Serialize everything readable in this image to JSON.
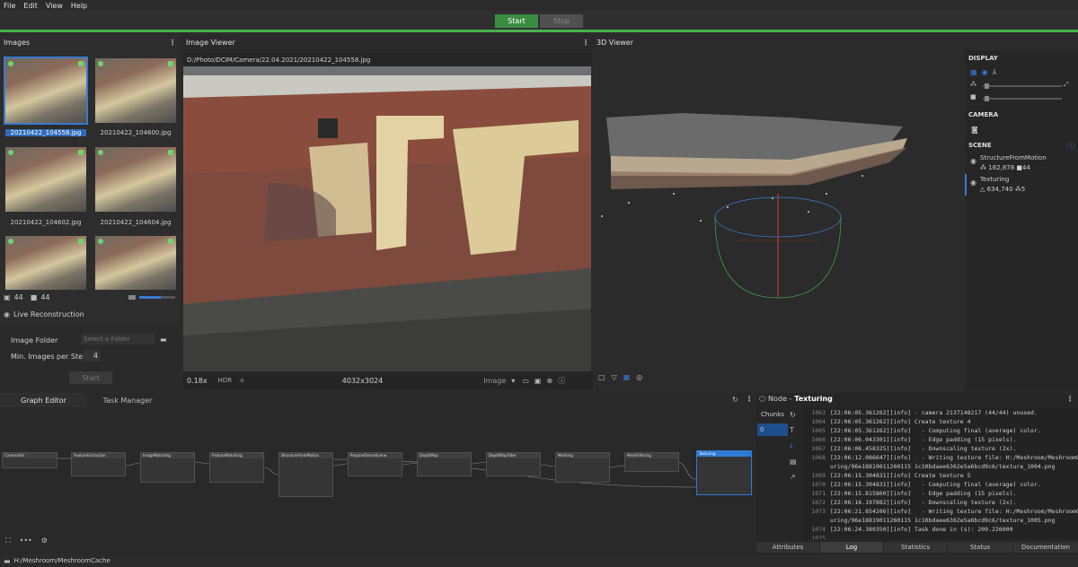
{
  "menu": [
    "File",
    "Edit",
    "View",
    "Help"
  ],
  "toolbar": {
    "start_label": "Start",
    "stop_label": "Stop"
  },
  "images_panel": {
    "title": "Images",
    "thumbnails": [
      {
        "label": "20210422_104558.jpg",
        "selected": true
      },
      {
        "label": "20210422_104600.jpg",
        "selected": false
      },
      {
        "label": "20210422_104602.jpg",
        "selected": false
      },
      {
        "label": "20210422_104604.jpg",
        "selected": false
      },
      {
        "label": "",
        "selected": false
      },
      {
        "label": "",
        "selected": false
      }
    ],
    "image_count": "44",
    "camera_count": "44",
    "live_reconstruction_label": "Live Reconstruction",
    "image_folder_label": "Image Folder",
    "image_folder_placeholder": "Select a Folder",
    "min_images_label": "Min. Images per Step",
    "min_images_value": "4",
    "start_label": "Start"
  },
  "image_viewer": {
    "title": "Image Viewer",
    "path": "D:/Photo/DCIM/Camera/22.04.2021/20210422_104558.jpg",
    "zoom": "0.18x",
    "hdr": "HDR",
    "resolution": "4032x3024",
    "mode": "Image"
  },
  "viewer_3d": {
    "title": "3D Viewer"
  },
  "display_panel": {
    "display_title": "DISPLAY",
    "camera_title": "CAMERA",
    "scene_title": "SCENE",
    "scene_items": [
      {
        "name": "StructureFromMotion",
        "points": "162,878",
        "cams": "44"
      },
      {
        "name": "Texturing",
        "points": "634,740",
        "cams": "5"
      }
    ]
  },
  "graph_editor": {
    "tabs": [
      "Graph Editor",
      "Task Manager"
    ],
    "nodes": [
      "CameraInit",
      "FeatureExtraction",
      "ImageMatching",
      "FeatureMatching",
      "StructureFromMotion",
      "PrepareDenseScene",
      "DepthMap",
      "DepthMapFilter",
      "Meshing",
      "MeshFiltering",
      "Texturing"
    ]
  },
  "node_panel": {
    "title_prefix": "Node - ",
    "node_name": "Texturing",
    "chunks_label": "Chunks",
    "chunk_index": "0",
    "log_lines": [
      [
        "1063",
        "[22:06:05.361262][info] - camera 2137148217 (44/44) unused."
      ],
      [
        "1064",
        "[22:06:05.361262][info] Create texture 4"
      ],
      [
        "1065",
        "[22:06:05.361262][info]   - Computing final (average) color."
      ],
      [
        "1066",
        "[22:06:06.043301][info]   - Edge padding (15 pixels)."
      ],
      [
        "1067",
        "[22:06:06.458325][info]   - Downscaling texture (2x)."
      ],
      [
        "1068",
        "[22:06:12.086647][info]   - Writing texture file: H:/Meshroom/MeshroomCache/Text"
      ],
      [
        "",
        "uring/96e18819011260115 1c10bdaee6362e5a6bcd9c6/texture_1004.png"
      ],
      [
        "1069",
        "[22:06:15.304831][info] Create texture 5"
      ],
      [
        "1070",
        "[22:06:15.304831][info]   - Computing final (average) color."
      ],
      [
        "1071",
        "[22:06:15.815860][info]   - Edge padding (15 pixels)."
      ],
      [
        "1072",
        "[22:06:16.197882][info]   - Downscaling texture (2x)."
      ],
      [
        "1073",
        "[22:06:21.854206][info]   - Writing texture file: H:/Meshroom/MeshroomCache/Text"
      ],
      [
        "",
        "uring/96e18819011260115 1c10bdaee6362e5a6bcd9c6/texture_1005.png"
      ],
      [
        "1074",
        "[22:06:24.380350][info] Task done in (s): 209.226000"
      ],
      [
        "1075",
        ""
      ]
    ],
    "bottom_tabs": [
      "Attributes",
      "Log",
      "Statistics",
      "Status",
      "Documentation"
    ]
  },
  "statusbar": {
    "path": "H:/Meshroom/MeshroomCache"
  }
}
